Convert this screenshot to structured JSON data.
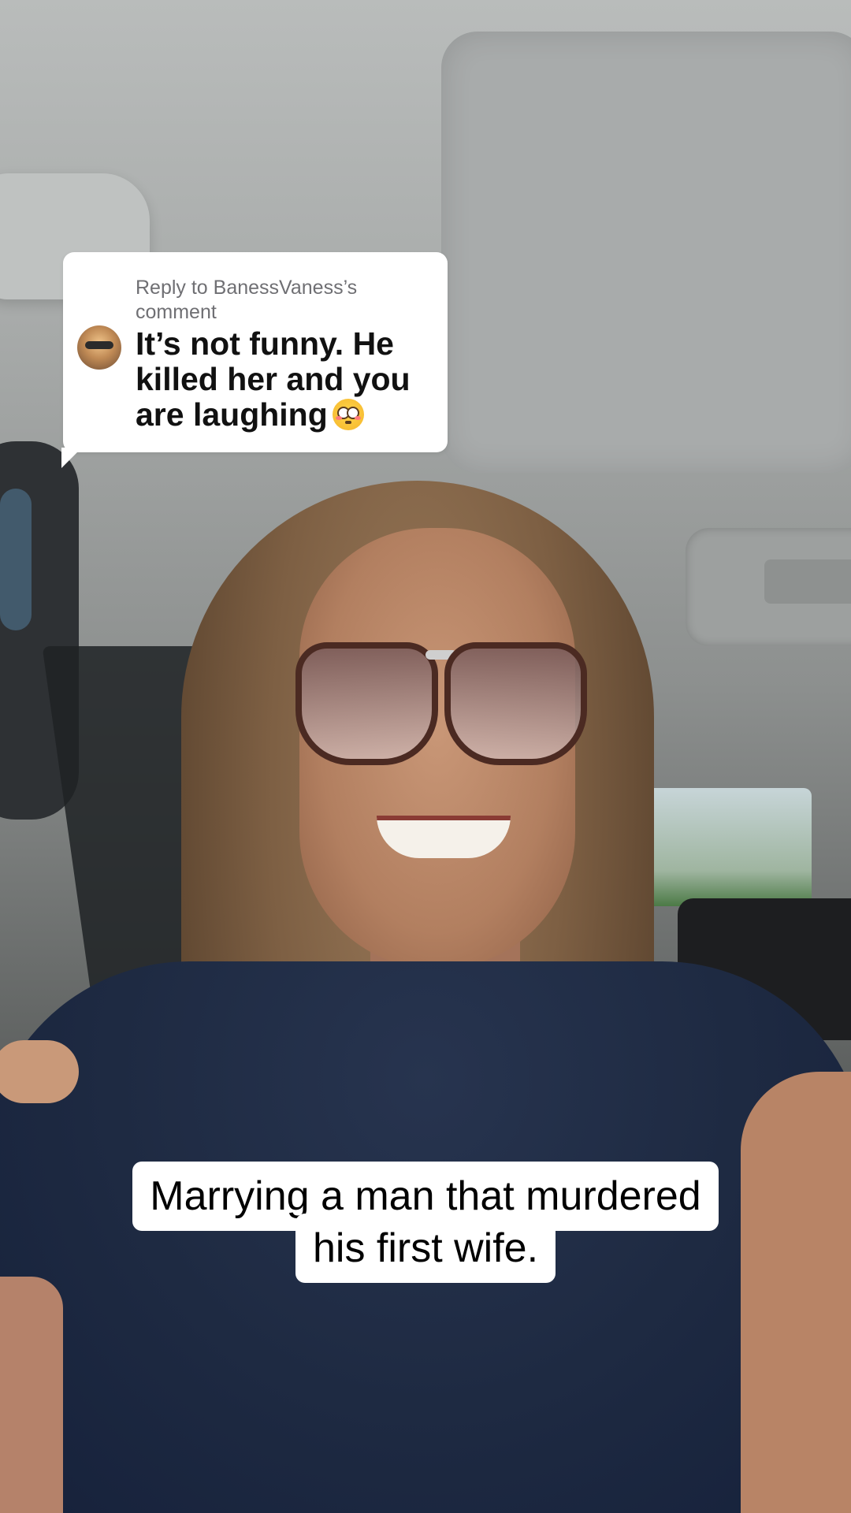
{
  "reply_sticker": {
    "header": "Reply to BanessVaness’s comment",
    "comment": "It’s not funny. He killed her and you are laughing",
    "emoji": "flushed-face"
  },
  "captions": {
    "line1": "Marrying a man that murdered",
    "line2": "his first wife."
  }
}
